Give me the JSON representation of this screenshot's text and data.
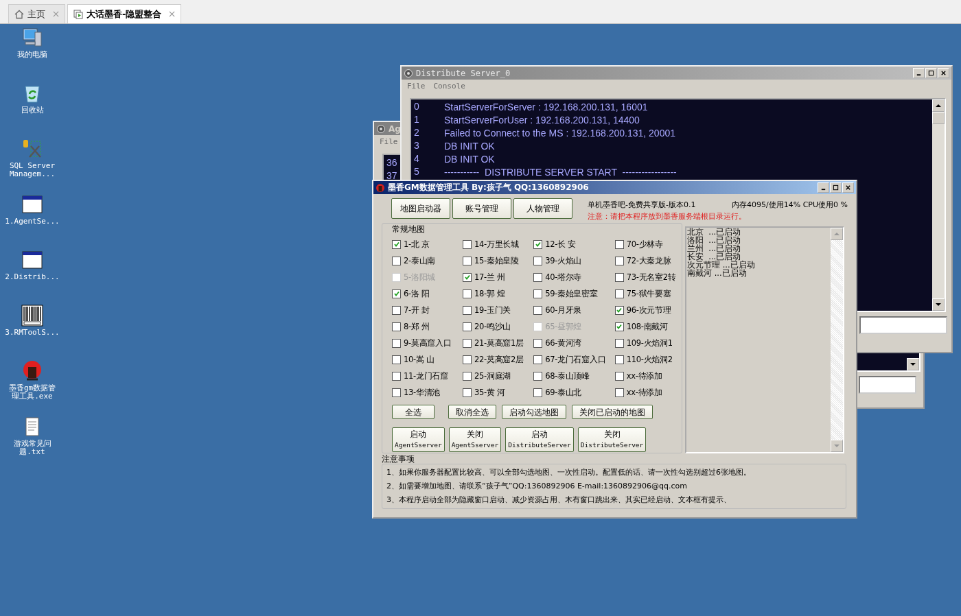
{
  "browser_tabs": [
    {
      "kind": "home",
      "label": "主页",
      "selected": false
    },
    {
      "kind": "page",
      "label": "大话墨香-隐盟整合",
      "selected": true
    }
  ],
  "desktop_icons": [
    {
      "kind": "computer",
      "lines": [
        "我的电脑"
      ]
    },
    {
      "kind": "recycle",
      "lines": [
        "回收站"
      ]
    },
    {
      "kind": "tools",
      "lines": [
        "SQL Server",
        "Managem..."
      ]
    },
    {
      "kind": "window",
      "lines": [
        "1.AgentSe..."
      ]
    },
    {
      "kind": "window",
      "lines": [
        "2.Distrib..."
      ]
    },
    {
      "kind": "barcode",
      "lines": [
        "3.RMToolS..."
      ]
    },
    {
      "kind": "app",
      "lines": [
        "墨香gm数据管",
        "理工具.exe"
      ]
    },
    {
      "kind": "text",
      "lines": [
        "游戏常见问",
        "题.txt"
      ]
    }
  ],
  "agent_window": {
    "title": "Ag",
    "menu": [
      "File"
    ],
    "console_lines": [
      "36",
      "37"
    ]
  },
  "distribute_window": {
    "title": "Distribute Server_0",
    "menu": [
      "File",
      "Console"
    ],
    "console_lines": [
      {
        "index": "0",
        "text": "StartServerForServer : 192.168.200.131, 16001"
      },
      {
        "index": "1",
        "text": "StartServerForUser : 192.168.200.131, 14400"
      },
      {
        "index": "2",
        "text": "Failed to Connect to the MS : 192.168.200.131, 20001"
      },
      {
        "index": "3",
        "text": "DB INIT OK"
      },
      {
        "index": "4",
        "text": "DB INIT OK"
      },
      {
        "index": "5",
        "text": "-----------  DISTRIBUTE SERVER START  -----------------"
      }
    ]
  },
  "gm_window": {
    "title": "墨香GM数据管理工具 By:孩子气 QQ:1360892906",
    "top_buttons": [
      "地图启动器",
      "账号管理",
      "人物管理"
    ],
    "version": "单机墨香吧-免费共享版-版本0.1",
    "memory": "内存4095/使用14% CPU使用0 %",
    "notice": "注意：请把本程序放到墨香服务端根目录运行。",
    "group_title": "常规地图",
    "map_columns": [
      [
        {
          "label": "1-北 京",
          "checked": true,
          "disabled": false
        },
        {
          "label": "2-泰山南",
          "checked": false,
          "disabled": false
        },
        {
          "label": "5-洛阳城",
          "checked": false,
          "disabled": true
        },
        {
          "label": "6-洛 阳",
          "checked": true,
          "disabled": false
        },
        {
          "label": "7-开 封",
          "checked": false,
          "disabled": false
        },
        {
          "label": "8-郑 州",
          "checked": false,
          "disabled": false
        },
        {
          "label": "9-莫高窟入口",
          "checked": false,
          "disabled": false
        },
        {
          "label": "10-嵩 山",
          "checked": false,
          "disabled": false
        },
        {
          "label": "11-龙门石窟",
          "checked": false,
          "disabled": false
        },
        {
          "label": "13-华清池",
          "checked": false,
          "disabled": false
        }
      ],
      [
        {
          "label": "14-万里长城",
          "checked": false,
          "disabled": false
        },
        {
          "label": "15-秦始皇陵",
          "checked": false,
          "disabled": false
        },
        {
          "label": "17-兰 州",
          "checked": true,
          "disabled": false
        },
        {
          "label": "18-郭 煌",
          "checked": false,
          "disabled": false
        },
        {
          "label": "19-玉门关",
          "checked": false,
          "disabled": false
        },
        {
          "label": "20-鸣沙山",
          "checked": false,
          "disabled": false
        },
        {
          "label": "21-莫高窟1层",
          "checked": false,
          "disabled": false
        },
        {
          "label": "22-莫高窟2层",
          "checked": false,
          "disabled": false
        },
        {
          "label": "25-洞庭湖",
          "checked": false,
          "disabled": false
        },
        {
          "label": "35-黄 河",
          "checked": false,
          "disabled": false
        }
      ],
      [
        {
          "label": "12-长 安",
          "checked": true,
          "disabled": false
        },
        {
          "label": "39-火焰山",
          "checked": false,
          "disabled": false
        },
        {
          "label": "40-塔尔寺",
          "checked": false,
          "disabled": false
        },
        {
          "label": "59-秦始皇密室",
          "checked": false,
          "disabled": false
        },
        {
          "label": "60-月牙泉",
          "checked": false,
          "disabled": false
        },
        {
          "label": "65-昼郭煌",
          "checked": false,
          "disabled": true
        },
        {
          "label": "66-黄河湾",
          "checked": false,
          "disabled": false
        },
        {
          "label": "67-龙门石窟入口",
          "checked": false,
          "disabled": false
        },
        {
          "label": "68-泰山顶峰",
          "checked": false,
          "disabled": false
        },
        {
          "label": "69-泰山北",
          "checked": false,
          "disabled": false
        }
      ],
      [
        {
          "label": "70-少林寺",
          "checked": false,
          "disabled": false
        },
        {
          "label": "72-大秦龙脉",
          "checked": false,
          "disabled": false
        },
        {
          "label": "73-无名室2转",
          "checked": false,
          "disabled": false
        },
        {
          "label": "75-狱牛要塞",
          "checked": false,
          "disabled": false
        },
        {
          "label": "96-次元节理",
          "checked": true,
          "disabled": false
        },
        {
          "label": "108-南戴河",
          "checked": true,
          "disabled": false
        },
        {
          "label": "109-火焰洞1",
          "checked": false,
          "disabled": false
        },
        {
          "label": "110-火焰洞2",
          "checked": false,
          "disabled": false
        },
        {
          "label": "xx-待添加",
          "checked": false,
          "disabled": false
        },
        {
          "label": "xx-待添加",
          "checked": false,
          "disabled": false
        }
      ]
    ],
    "action_buttons": [
      "全选",
      "取消全选",
      "启动勾选地图",
      "关闭已启动的地图"
    ],
    "server_buttons": [
      {
        "line1": "启动",
        "line2": "AgentSserver"
      },
      {
        "line1": "关闭",
        "line2": "AgentSserver"
      },
      {
        "line1": "启动",
        "line2": "DistributeServer"
      },
      {
        "line1": "关闭",
        "line2": "DistributeServer"
      }
    ],
    "log_lines": [
      "北京  ...已启动",
      "洛阳  ...已启动",
      "兰州  ...已启动",
      "长安  ...已启动",
      "次元节理 ...已启动",
      "南戴河 ...已启动"
    ],
    "notes_title": "注意事项",
    "notes": [
      "1、如果你服务器配置比较高、可以全部勾选地图、一次性启动。配置低的话、请一次性勾选别超过6张地图。",
      "2、如需要增加地图、请联系“孩子气”QQ:1360892906 E-mail:1360892906@qq.com",
      "3、本程序启动全部为隐藏窗口启动、减少资源占用、木有窗口跳出来、其实已经启动、文本框有提示、"
    ]
  }
}
